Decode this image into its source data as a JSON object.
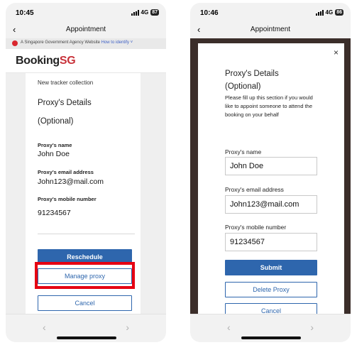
{
  "status_left": {
    "time": "10:45",
    "network": "4G",
    "battery": "87"
  },
  "status_right": {
    "time": "10:46",
    "network": "4G",
    "battery": "86"
  },
  "nav": {
    "back_glyph": "‹",
    "title": "Appointment"
  },
  "gov_banner": {
    "text": "A Singapore Government Agency Website",
    "link": "How to identify ˅"
  },
  "brand": {
    "name_main": "Booking",
    "name_accent": "SG",
    "accent_color": "#c8323a"
  },
  "left_card": {
    "collection": "New tracker collection",
    "heading_line1": "Proxy's Details",
    "heading_line2": "(Optional)",
    "fields": [
      {
        "label": "Proxy's name",
        "value": "John Doe"
      },
      {
        "label": "Proxy's email address",
        "value": "John123@mail.com"
      },
      {
        "label": "Proxy's mobile number",
        "value": "91234567"
      }
    ],
    "buttons": {
      "reschedule": "Reschedule",
      "manage_proxy": "Manage proxy",
      "cancel": "Cancel"
    },
    "highlight_color": "#e60012"
  },
  "modal": {
    "close_glyph": "×",
    "heading_line1": "Proxy's Details",
    "heading_line2": "(Optional)",
    "description": "Please fill up this section if you would like to appoint someone to attend the booking on your behalf",
    "fields": [
      {
        "label": "Proxy's name",
        "value": "John Doe"
      },
      {
        "label": "Proxy's email address",
        "value": "John123@mail.com"
      },
      {
        "label": "Proxy's mobile number",
        "value": "91234567"
      }
    ],
    "buttons": {
      "submit": "Submit",
      "delete": "Delete Proxy",
      "cancel": "Cancel"
    }
  },
  "bottom_nav": {
    "prev": "‹",
    "next": "›"
  },
  "colors": {
    "primary": "#2e66ad",
    "overlay": "#3b2e2a"
  }
}
